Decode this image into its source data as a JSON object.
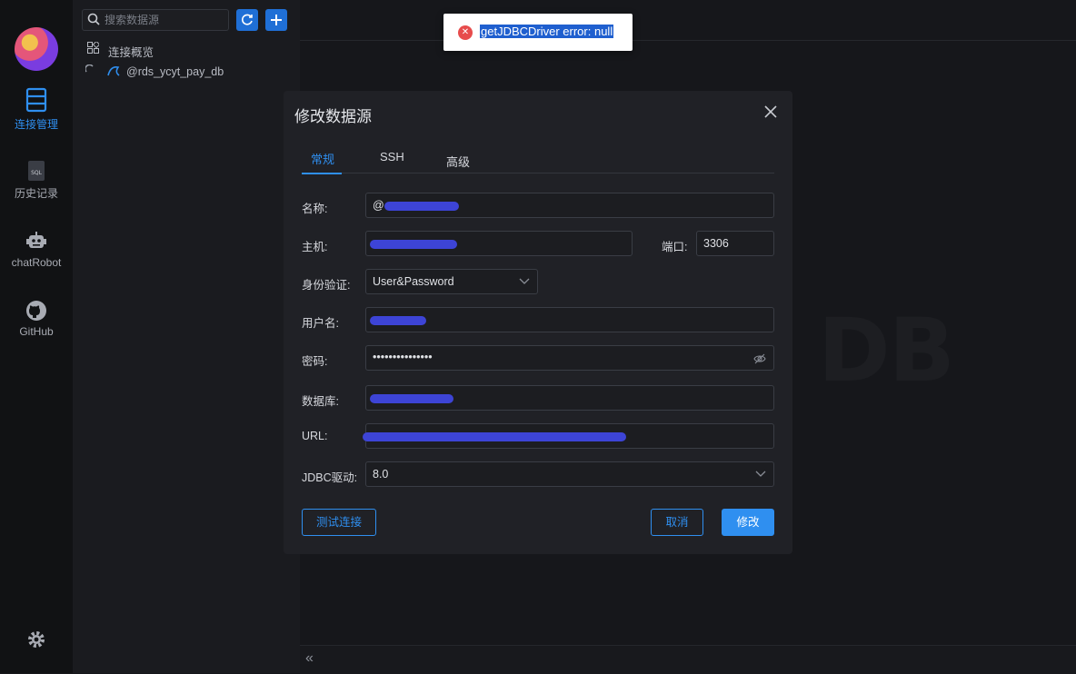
{
  "search": {
    "placeholder": "搜索数据源"
  },
  "nav": {
    "items": [
      {
        "label": "连接管理",
        "icon": "database-icon",
        "active": true
      },
      {
        "label": "历史记录",
        "icon": "sql-file-icon",
        "active": false
      },
      {
        "label": "chatRobot",
        "icon": "robot-icon",
        "active": false
      },
      {
        "label": "GitHub",
        "icon": "github-icon",
        "active": false
      }
    ],
    "settings_icon": "gear-icon"
  },
  "tree": {
    "overview": "连接概览",
    "connection": "@rds_ycyt_pay_db"
  },
  "watermark": "DB",
  "toast": {
    "message": "getJDBCDriver error: null",
    "icon": "error-circle-icon"
  },
  "modal": {
    "title": "修改数据源",
    "tabs": [
      "常规",
      "SSH",
      "高级"
    ],
    "active_tab": "常规",
    "fields": {
      "name_label": "名称:",
      "name_value": "@",
      "host_label": "主机:",
      "host_value": "",
      "port_label": "端口:",
      "port_value": "3306",
      "auth_label": "身份验证:",
      "auth_value": "User&Password",
      "user_label": "用户名:",
      "password_label": "密码:",
      "password_value": "•••••••••••••••",
      "database_label": "数据库:",
      "url_label": "URL:",
      "driver_label": "JDBC驱动:",
      "driver_value": "8.0"
    },
    "buttons": {
      "test": "测试连接",
      "cancel": "取消",
      "submit": "修改"
    }
  },
  "colors": {
    "accent": "#2f8ff0",
    "error": "#e74c4c",
    "background": "#16171b"
  }
}
